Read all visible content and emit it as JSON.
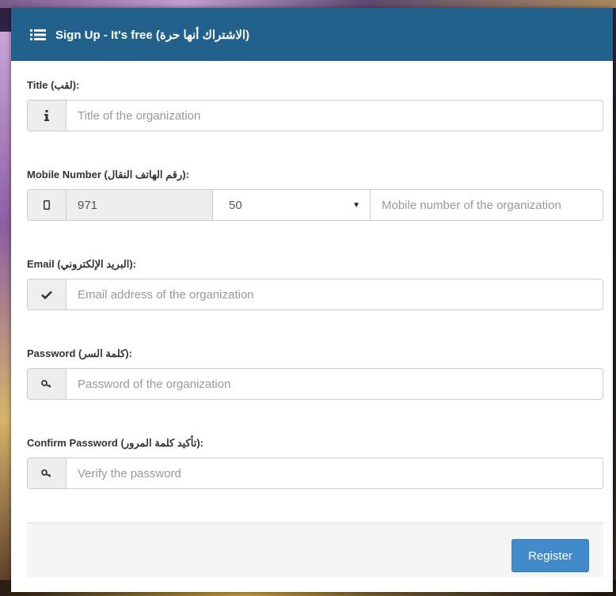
{
  "header": {
    "title": "Sign Up - It's free (الاشتراك أنها حرة)"
  },
  "form": {
    "title": {
      "label": "Title (لقب):",
      "placeholder": "Title of the organization"
    },
    "mobile": {
      "label": "Mobile Number (رقم الهاتف النقال):",
      "country_code": "971",
      "prefix": "50",
      "placeholder": "Mobile number of the organization"
    },
    "email": {
      "label": "Email (البريد الإلكتروني):",
      "placeholder": "Email address of the organization"
    },
    "password": {
      "label": "Password (كلمة السر):",
      "placeholder": "Password of the organization"
    },
    "confirm": {
      "label": "Confirm Password (تأكيد كلمة المرور):",
      "placeholder": "Verify the password"
    }
  },
  "footer": {
    "register_label": "Register"
  },
  "colors": {
    "header_bg": "#21618c",
    "button_bg": "#428bca"
  },
  "icons": {
    "header": "list-icon",
    "title": "info-icon",
    "mobile": "mobile-icon",
    "email": "check-icon",
    "password": "key-icon",
    "confirm": "key-icon"
  }
}
